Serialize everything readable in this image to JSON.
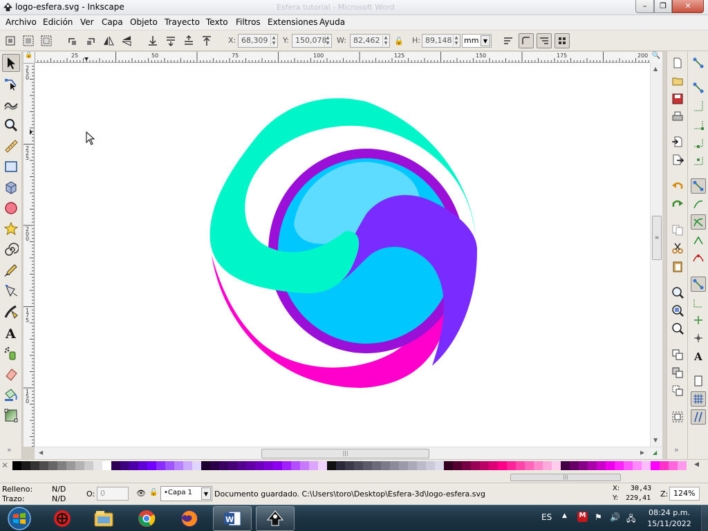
{
  "window": {
    "title": "logo-esfera.svg - Inkscape",
    "background_title": "Esfera tutorial - Microsoft Word",
    "min_label": "–",
    "max_label": "❐",
    "close_label": "✕"
  },
  "menu": [
    "Archivo",
    "Edición",
    "Ver",
    "Capa",
    "Objeto",
    "Trayecto",
    "Texto",
    "Filtros",
    "Extensiones",
    "Ayuda"
  ],
  "toolcontrols": {
    "x_label": "X:",
    "x_value": "68,309",
    "y_label": "Y:",
    "y_value": "150,078",
    "w_label": "W:",
    "w_value": "82,462",
    "h_label": "H:",
    "h_value": "89,148",
    "lock_glyph": "🔓",
    "unit": "mm"
  },
  "ruler": {
    "h_labels": [
      "25",
      "50",
      "75",
      "100",
      "125",
      "150",
      "175",
      "200"
    ],
    "v_labels": [
      "250",
      "225",
      "200",
      "175",
      "150"
    ]
  },
  "palette_colors": [
    "#000000",
    "#1a1a1a",
    "#333333",
    "#4d4d4d",
    "#666666",
    "#808080",
    "#999999",
    "#b3b3b3",
    "#cccccc",
    "#e6e6e6",
    "#ffffff",
    "#2b0055",
    "#3c0080",
    "#4d00aa",
    "#5f00d5",
    "#7000ff",
    "#8a2bff",
    "#a055ff",
    "#b680ff",
    "#cbaaff",
    "#e1d5ff",
    "#1c0030",
    "#2a0048",
    "#380060",
    "#460078",
    "#540090",
    "#6200a8",
    "#7000c0",
    "#7e00d8",
    "#8c00f0",
    "#a020ff",
    "#b44dff",
    "#c87aff",
    "#dca6ff",
    "#f0d3ff",
    "#101010",
    "#2a2a3a",
    "#3a3a4a",
    "#4a4a5a",
    "#5a5a6a",
    "#6a6a7a",
    "#7a7a8a",
    "#8a8a9a",
    "#9a9aaa",
    "#aaaaba",
    "#babaca",
    "#cacada",
    "#dadaea",
    "#330022",
    "#550033",
    "#770044",
    "#990055",
    "#bb0066",
    "#dd0077",
    "#ff0088",
    "#ff2299",
    "#ff44aa",
    "#ff66bb",
    "#ff88cc",
    "#ffaadd",
    "#ffccee",
    "#440044",
    "#660066",
    "#880088",
    "#aa00aa",
    "#cc00cc",
    "#ee00ee",
    "#ff22ff",
    "#ff55ff",
    "#ff88ff",
    "#ffbbff",
    "#ff00ff",
    "#ff33cc",
    "#ff66dd",
    "#ff99ee",
    "#ffccf5"
  ],
  "status": {
    "fill_label": "Relleno:",
    "fill_value": "N/D",
    "stroke_label": "Trazo:",
    "stroke_value": "N/D",
    "opacity_label": "O:",
    "opacity_value": "0",
    "layer": "•Capa 1",
    "message": "Documento guardado. C:\\Users\\toro\\Desktop\\Esfera-3d\\logo-esfera.svg",
    "cursor_x_label": "X:",
    "cursor_x": "30,43",
    "cursor_y_label": "Y:",
    "cursor_y": "229,41",
    "zoom_label": "Z:",
    "zoom": "124%"
  },
  "taskbar": {
    "lang": "ES",
    "time": "08:24 p.m.",
    "date": "15/11/2022"
  },
  "colors": {
    "teal": "#00f5c8",
    "purple_ring": "#9b10d8",
    "blue_sphere": "#00c8ff",
    "highlight": "#5ddcff",
    "violet": "#7a2bff",
    "magenta": "#ff00cc"
  }
}
